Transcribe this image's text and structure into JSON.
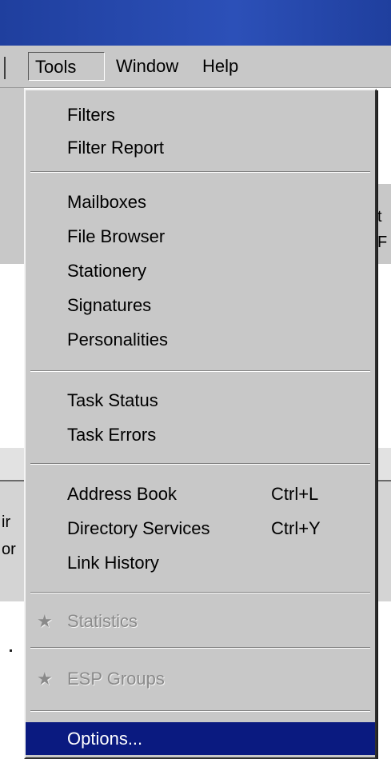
{
  "menubar": {
    "tools": "Tools",
    "window": "Window",
    "help": "Help"
  },
  "background": {
    "frag_left_1": "ir",
    "frag_left_2": "or",
    "frag_right_1": "t",
    "frag_right_2": "F"
  },
  "tools_menu": {
    "filters": "Filters",
    "filter_report": "Filter Report",
    "mailboxes": "Mailboxes",
    "file_browser": "File Browser",
    "stationery": "Stationery",
    "signatures": "Signatures",
    "personalities": "Personalities",
    "task_status": "Task Status",
    "task_errors": "Task Errors",
    "address_book": "Address Book",
    "address_book_shortcut": "Ctrl+L",
    "directory_services": "Directory Services",
    "directory_services_shortcut": "Ctrl+Y",
    "link_history": "Link History",
    "statistics": "Statistics",
    "esp_groups": "ESP Groups",
    "options": "Options...",
    "star_icon_glyph": "★"
  }
}
